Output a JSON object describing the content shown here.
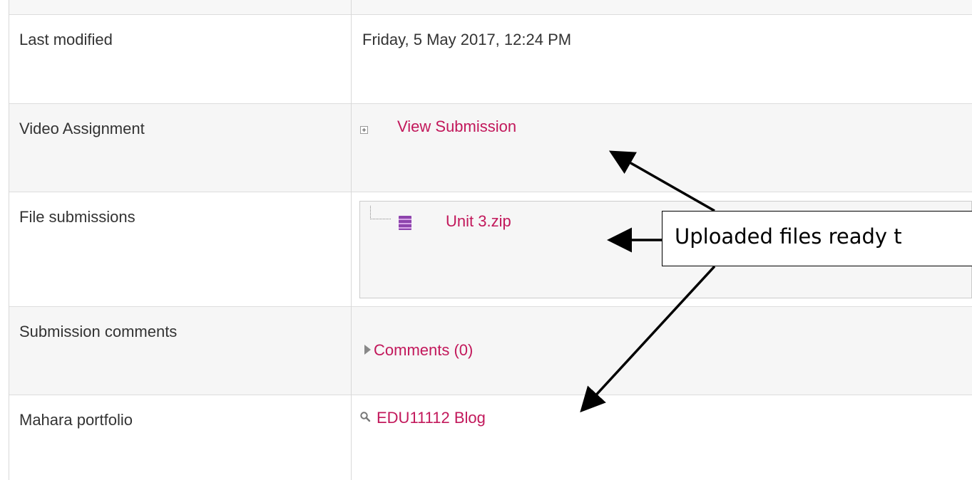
{
  "rows": [
    {
      "label": "Last modified",
      "value": "Friday, 5 May 2017, 12:24 PM"
    },
    {
      "label": "Video Assignment",
      "link": "View Submission",
      "icon": "expand-plus-icon"
    },
    {
      "label": "File submissions",
      "file_name": "Unit 3.zip",
      "icon": "zip-file-icon"
    },
    {
      "label": "Submission comments",
      "link": "Comments (0)",
      "icon": "collapsed-triangle-icon"
    },
    {
      "label": "Mahara portfolio",
      "link": "EDU11112 Blog",
      "icon": "magnifier-icon"
    }
  ],
  "callout": {
    "text": "Uploaded files ready t"
  },
  "colors": {
    "link": "#c2185b",
    "text": "#333333",
    "alt_row": "#f6f6f6",
    "zip_icon": "#8e44ad"
  }
}
